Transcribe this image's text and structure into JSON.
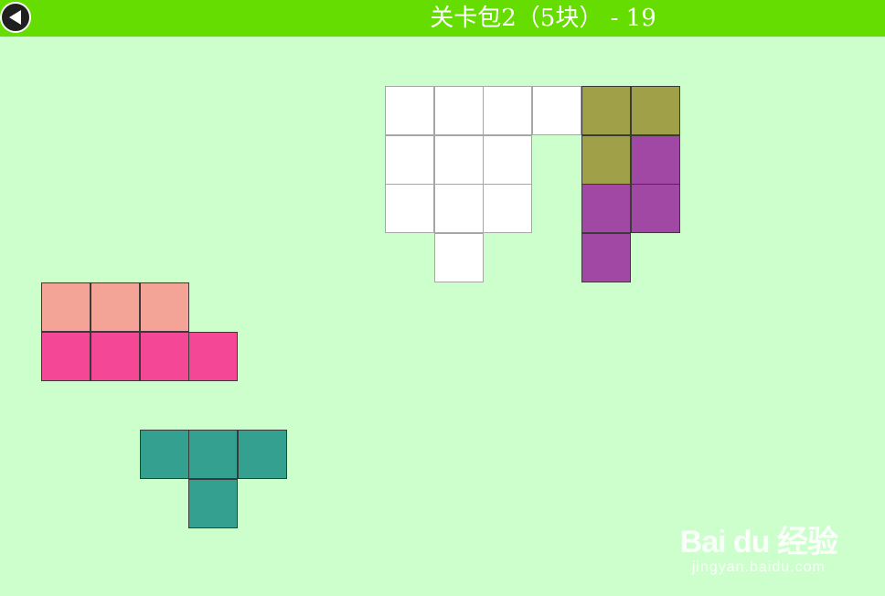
{
  "header": {
    "title": "关卡包2（5块） - 19",
    "back_icon": "back-arrow-icon",
    "bar_color": "#66dd00"
  },
  "board": {
    "background": "#ccffcc",
    "target_color": "#ffffff",
    "pieces": [
      {
        "name": "olive-piece",
        "color": "#a0a048",
        "cells": [
          [
            4,
            0
          ],
          [
            5,
            0
          ],
          [
            4,
            1
          ]
        ]
      },
      {
        "name": "purple-piece",
        "color": "#a148a4",
        "cells": [
          [
            5,
            1
          ],
          [
            4,
            2
          ],
          [
            5,
            2
          ],
          [
            4,
            3
          ]
        ]
      },
      {
        "name": "salmon-piece",
        "color": "#f4a496",
        "cells": [
          [
            -7,
            4
          ],
          [
            -6,
            4
          ],
          [
            -5,
            4
          ]
        ]
      },
      {
        "name": "pink-piece",
        "color": "#f44896",
        "cells": [
          [
            -7,
            5
          ],
          [
            -6,
            5
          ],
          [
            -5,
            5
          ],
          [
            -4,
            5
          ]
        ]
      },
      {
        "name": "teal-piece",
        "color": "#34a08f",
        "cells": [
          [
            -5,
            7
          ],
          [
            -4,
            7
          ],
          [
            -3,
            7
          ],
          [
            -4,
            8
          ]
        ]
      }
    ],
    "target_cells": [
      [
        0,
        0
      ],
      [
        1,
        0
      ],
      [
        2,
        0
      ],
      [
        3,
        0
      ],
      [
        0,
        1
      ],
      [
        1,
        1
      ],
      [
        2,
        1
      ],
      [
        0,
        2
      ],
      [
        1,
        2
      ],
      [
        2,
        2
      ],
      [
        1,
        3
      ]
    ]
  },
  "watermark": {
    "logo": "Bai du 经验",
    "url": "jingyan.baidu.com"
  }
}
